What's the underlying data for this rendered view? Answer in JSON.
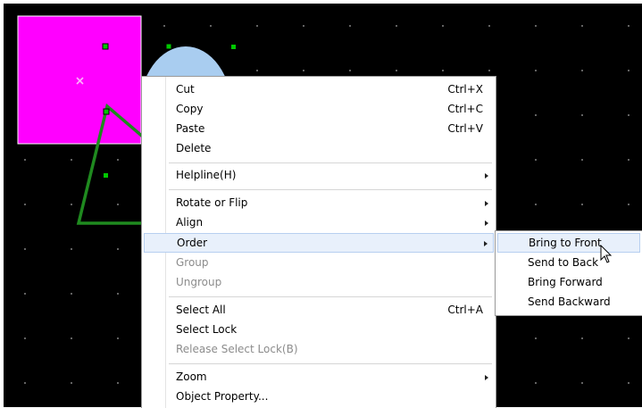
{
  "canvas": {
    "background": "#000000",
    "grid_dot_color": "#7d7d7d",
    "shape_colors": {
      "square_fill": "#ff00ff",
      "ellipse_fill": "#a9cdf0",
      "triangle_stroke": "#1f8a1f",
      "handle_fill": "#00c800"
    }
  },
  "context_menu": {
    "items": [
      {
        "label": "Cut",
        "shortcut": "Ctrl+X"
      },
      {
        "label": "Copy",
        "shortcut": "Ctrl+C"
      },
      {
        "label": "Paste",
        "shortcut": "Ctrl+V"
      },
      {
        "label": "Delete"
      },
      {
        "label": "Helpline(H)"
      },
      {
        "label": "Rotate or Flip"
      },
      {
        "label": "Align"
      },
      {
        "label": "Order"
      },
      {
        "label": "Group"
      },
      {
        "label": "Ungroup"
      },
      {
        "label": "Select All",
        "shortcut": "Ctrl+A"
      },
      {
        "label": "Select Lock"
      },
      {
        "label": "Release Select Lock(B)"
      },
      {
        "label": "Zoom"
      },
      {
        "label": "Object Property..."
      }
    ]
  },
  "submenu": {
    "items": [
      {
        "label": "Bring to Front"
      },
      {
        "label": "Send to Back"
      },
      {
        "label": "Bring Forward"
      },
      {
        "label": "Send Backward"
      }
    ]
  },
  "icons": {
    "submenu_arrow": "chevron-right-icon",
    "mouse_cursor": "arrow-cursor-icon",
    "center_marker": "x-marker-icon"
  }
}
